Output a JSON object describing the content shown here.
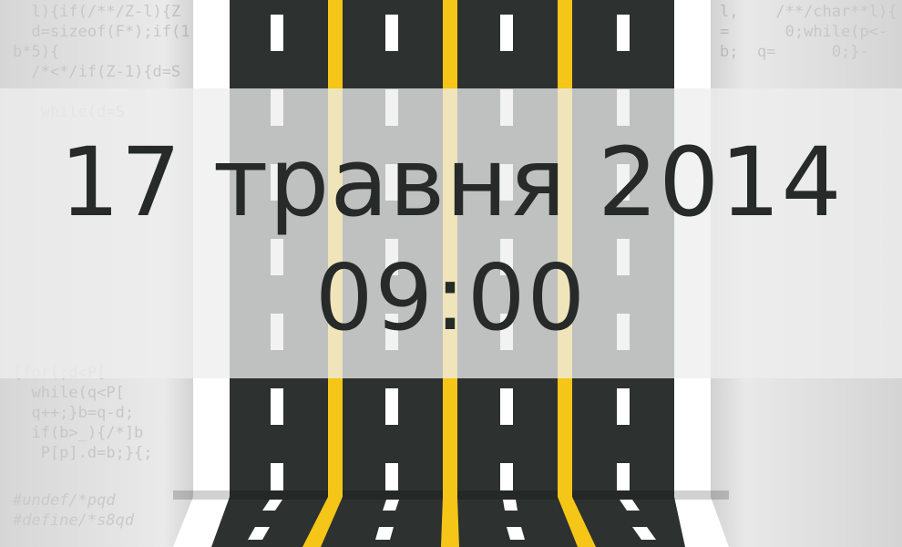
{
  "event": {
    "date": "17 травня 2014",
    "time": "09:00"
  },
  "background_code": {
    "left_lines": [
      "  l){if(/**/Z-l){Z",
      "  d=sizeof(F*);if(1",
      "b*5){",
      "  /*<*/if(Z-1){d=S",
      "",
      "   while(d=S",
      "",
      "",
      "",
      "",
      "",
      "",
      "",
      "",
      "",
      "",
      "",
      "",
      "{for(;d<P[",
      "  while(q<P[",
      "  q++;}b=q-d;",
      "  if(b>_){/*]b",
      "   P[p].d=b;}{;"
    ],
    "left_italic_lines": [
      "#undef/*pqd",
      "#define/*s8qd"
    ],
    "right_lines": [
      "l,    /**/char**l){",
      "=      0;while(p<-",
      "b;  q=      0;}-"
    ]
  },
  "colors": {
    "asphalt": "#2d312f",
    "lane_yellow": "#f5c518",
    "dash_white": "#ffffff",
    "text_dark": "#262a28",
    "band_overlay": "rgba(238,238,238,0.76)"
  }
}
